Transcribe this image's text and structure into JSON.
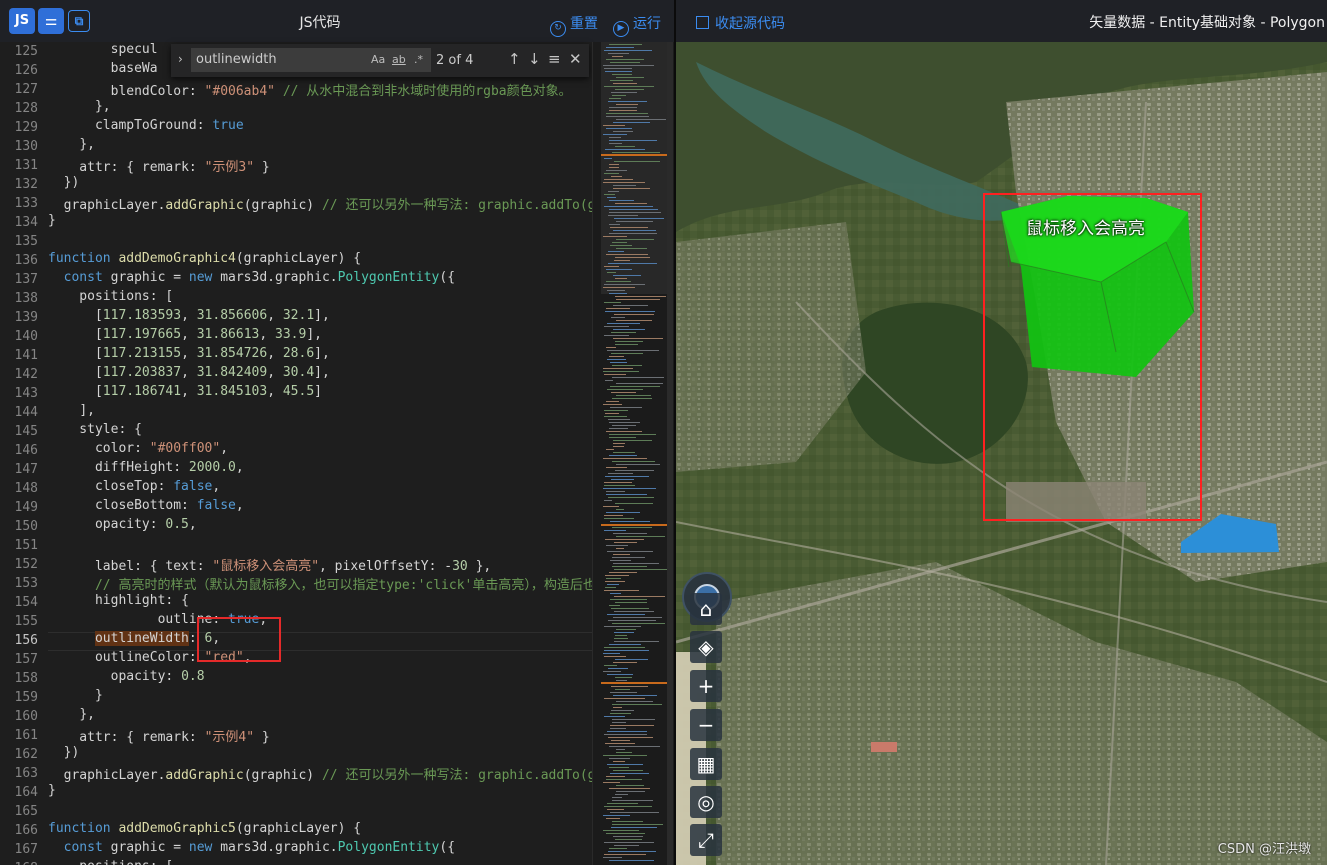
{
  "toolbar": {
    "js_label": "JS",
    "title": "JS代码",
    "reset_label": "重置",
    "run_label": "运行"
  },
  "find": {
    "query": "outlinewidth",
    "match_case": "Aa",
    "whole_word": "ab",
    "regex": ".*",
    "count": "2 of 4"
  },
  "editor": {
    "line_numbers": [
      "125",
      "126",
      "127",
      "128",
      "129",
      "130",
      "131",
      "132",
      "133",
      "134",
      "135",
      "136",
      "137",
      "138",
      "139",
      "140",
      "141",
      "142",
      "143",
      "144",
      "145",
      "146",
      "147",
      "148",
      "149",
      "150",
      "151",
      "152",
      "153",
      "154",
      "155",
      "156",
      "157",
      "158",
      "159",
      "160",
      "161",
      "162",
      "163",
      "164",
      "165",
      "166",
      "167",
      "168"
    ],
    "current_line": "156",
    "lines": [
      "        specul",
      "        baseWa",
      "        blendColor: \"#006ab4\" // 从水中混合到非水域时使用的rgba颜色对象。",
      "      },",
      "      clampToGround: true",
      "    },",
      "    attr: { remark: \"示例3\" }",
      "  })",
      "  graphicLayer.addGraphic(graphic) // 还可以另外一种写法: graphic.addTo(graphicLayer)",
      "}",
      "",
      "function addDemoGraphic4(graphicLayer) {",
      "  const graphic = new mars3d.graphic.PolygonEntity({",
      "    positions: [",
      "      [117.183593, 31.856606, 32.1],",
      "      [117.197665, 31.86613, 33.9],",
      "      [117.213155, 31.854726, 28.6],",
      "      [117.203837, 31.842409, 30.4],",
      "      [117.186741, 31.845103, 45.5]",
      "    ],",
      "    style: {",
      "      color: \"#00ff00\",",
      "      diffHeight: 2000.0,",
      "      closeTop: false,",
      "      closeBottom: false,",
      "      opacity: 0.5,",
      "",
      "      label: { text: \"鼠标移入会高亮\", pixelOffsetY: -30 },",
      "      // 高亮时的样式（默认为鼠标移入，也可以指定type:'click'单击高亮），构造后也可以openHighlight、closeHighlight方法来手动调用",
      "      highlight: {",
      "              outline: true,",
      "      outlineWidth: 6,",
      "      outlineColor: \"red\",",
      "        opacity: 0.8",
      "      }",
      "    },",
      "    attr: { remark: \"示例4\" }",
      "  })",
      "  graphicLayer.addGraphic(graphic) // 还可以另外一种写法: graphic.addTo(graphicLayer)",
      "}",
      "",
      "function addDemoGraphic5(graphicLayer) {",
      "  const graphic = new mars3d.graphic.PolygonEntity({",
      "    positions: ["
    ]
  },
  "map": {
    "collapse_label": "收起源代码",
    "title": "矢量数据 - Entity基础对象 - Polygon",
    "polygon_label": "鼠标移入会高亮",
    "watermark": "CSDN @汪洪墩",
    "colors": {
      "polygon": "#00ff00",
      "highlight_outline": "red",
      "water": "#2c8fd8"
    },
    "controls": [
      "compass-icon",
      "home-icon",
      "layers-icon",
      "zoom-in-icon",
      "zoom-out-icon",
      "basemap-icon",
      "globe-icon",
      "fullscreen-icon"
    ]
  }
}
